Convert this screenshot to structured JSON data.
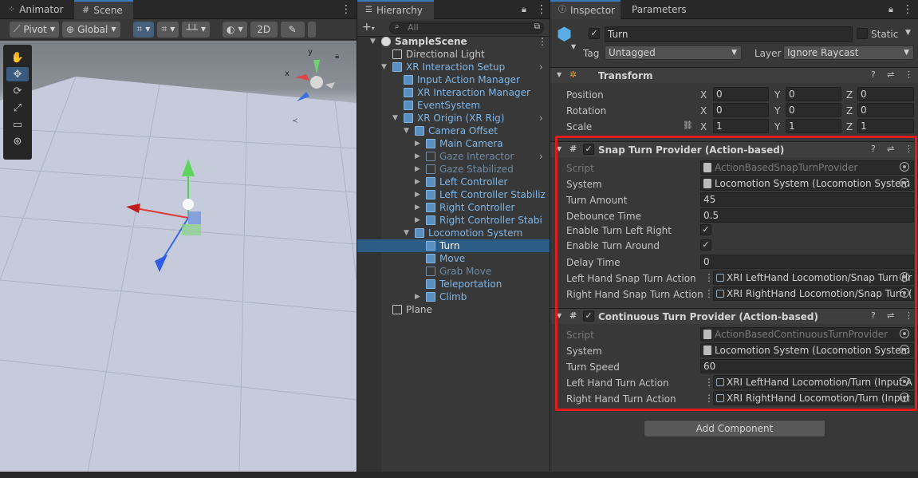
{
  "scene_window": {
    "tabs": [
      {
        "label": "Animator",
        "icon": "animator-icon"
      },
      {
        "label": "Scene",
        "icon": "scene-grid-icon"
      }
    ],
    "toolbar": {
      "pivot": "Pivot",
      "global": "Global",
      "mode_2d": "2D"
    },
    "gizmo": {
      "y": "y",
      "x": "x"
    }
  },
  "hierarchy": {
    "tab": "Hierarchy",
    "search_placeholder": "All",
    "items": [
      {
        "label": "SampleScene",
        "depth": 0,
        "kind": "scene"
      },
      {
        "label": "Directional Light",
        "depth": 1,
        "kind": "object"
      },
      {
        "label": "XR Interaction Setup",
        "depth": 1,
        "kind": "prefab"
      },
      {
        "label": "Input Action Manager",
        "depth": 2,
        "kind": "prefab"
      },
      {
        "label": "XR Interaction Manager",
        "depth": 2,
        "kind": "prefab"
      },
      {
        "label": "EventSystem",
        "depth": 2,
        "kind": "prefab"
      },
      {
        "label": "XR Origin (XR Rig)",
        "depth": 2,
        "kind": "prefab"
      },
      {
        "label": "Camera Offset",
        "depth": 3,
        "kind": "prefab"
      },
      {
        "label": "Main Camera",
        "depth": 4,
        "kind": "prefab"
      },
      {
        "label": "Gaze Interactor",
        "depth": 4,
        "kind": "dim"
      },
      {
        "label": "Gaze Stabilized",
        "depth": 4,
        "kind": "dim"
      },
      {
        "label": "Left Controller",
        "depth": 4,
        "kind": "prefab"
      },
      {
        "label": "Left Controller Stabiliz",
        "depth": 4,
        "kind": "prefab"
      },
      {
        "label": "Right Controller",
        "depth": 4,
        "kind": "prefab"
      },
      {
        "label": "Right Controller Stabi",
        "depth": 4,
        "kind": "prefab"
      },
      {
        "label": "Locomotion System",
        "depth": 3,
        "kind": "prefab"
      },
      {
        "label": "Turn",
        "depth": 4,
        "kind": "selected"
      },
      {
        "label": "Move",
        "depth": 4,
        "kind": "prefab"
      },
      {
        "label": "Grab Move",
        "depth": 4,
        "kind": "dim"
      },
      {
        "label": "Teleportation",
        "depth": 4,
        "kind": "prefab"
      },
      {
        "label": "Climb",
        "depth": 4,
        "kind": "prefab"
      },
      {
        "label": "Plane",
        "depth": 1,
        "kind": "object"
      }
    ]
  },
  "inspector": {
    "tabs": [
      {
        "label": "Inspector"
      },
      {
        "label": "Parameters"
      }
    ],
    "object": {
      "name": "Turn",
      "static_label": "Static",
      "tag_label": "Tag",
      "tag": "Untagged",
      "layer_label": "Layer",
      "layer": "Ignore Raycast"
    },
    "transform": {
      "title": "Transform",
      "rows": [
        {
          "label": "Position",
          "x": "0",
          "y": "0",
          "z": "0"
        },
        {
          "label": "Rotation",
          "x": "0",
          "y": "0",
          "z": "0"
        },
        {
          "label": "Scale",
          "x": "1",
          "y": "1",
          "z": "1"
        }
      ],
      "axes": {
        "x": "X",
        "y": "Y",
        "z": "Z"
      }
    },
    "snap": {
      "title": "Snap Turn Provider (Action-based)",
      "script_label": "Script",
      "script": "ActionBasedSnapTurnProvider",
      "system_label": "System",
      "system": "Locomotion System (Locomotion System",
      "turn_amount_label": "Turn Amount",
      "turn_amount": "45",
      "debounce_label": "Debounce Time",
      "debounce": "0.5",
      "enable_lr_label": "Enable Turn Left Right",
      "enable_around_label": "Enable Turn Around",
      "delay_label": "Delay Time",
      "delay": "0",
      "left_label": "Left Hand Snap Turn Action",
      "left": "XRI LeftHand Locomotion/Snap Turn (Ir",
      "right_label": "Right Hand Snap Turn Action",
      "right": "XRI RightHand Locomotion/Snap Turn ("
    },
    "continuous": {
      "title": "Continuous Turn Provider (Action-based)",
      "script_label": "Script",
      "script": "ActionBasedContinuousTurnProvider",
      "system_label": "System",
      "system": "Locomotion System (Locomotion System",
      "speed_label": "Turn Speed",
      "speed": "60",
      "left_label": "Left Hand Turn Action",
      "left": "XRI LeftHand Locomotion/Turn (Input A",
      "right_label": "Right Hand Turn Action",
      "right": "XRI RightHand Locomotion/Turn (Input"
    },
    "add_component": "Add Component"
  },
  "colors": {
    "accent": "#2c5d87",
    "highlight_box": "#e21c1c",
    "prefab_text": "#7fb6e8"
  }
}
